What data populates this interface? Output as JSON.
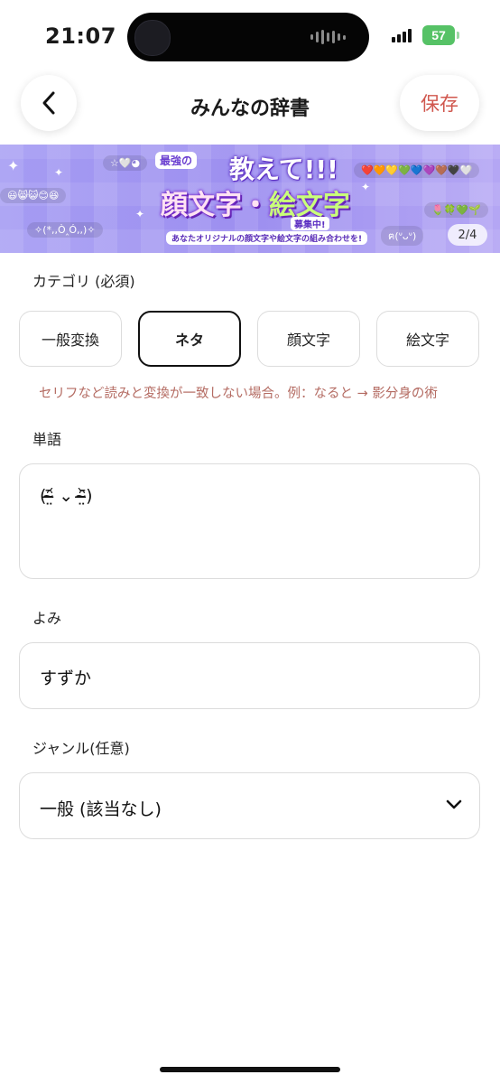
{
  "status_bar": {
    "time": "21:07",
    "battery": "57"
  },
  "header": {
    "title": "みんなの辞書",
    "save_label": "保存"
  },
  "banner": {
    "subtitle": "最強の",
    "title_line1": "教えて!!!",
    "title_kaomoji": "顔文字",
    "title_connector": "・",
    "title_emoji": "絵文字",
    "badge": "募集中!",
    "caption": "あなたオリジナルの顔文字や絵文字の組み合わせを!",
    "kaomoji_left_top": "☆🤍◕",
    "kaomoji_left_mid": "😃😸😺😊😆",
    "kaomoji_left_bottom": "✧(*,,Ò‸Ó,,)✧",
    "emoji_right_top": "❤️🧡💛💚💙💜🤎🖤🤍",
    "emoji_right_mid": "🌷🍀💚🌱",
    "kaomoji_right_bottom": "ฅ(ᐡᴗᐡ)",
    "pager": "2/4"
  },
  "category": {
    "label": "カテゴリ (必須)",
    "options": [
      "一般変換",
      "ネタ",
      "顔文字",
      "絵文字"
    ],
    "selected": "ネタ",
    "hint": "セリフなど読みと変換が一致しない場合。例：なると → 影分身の術"
  },
  "word": {
    "label": "単語",
    "value": "(ᵔ̴̶̤᷄ ⌄ ᵔ̴̶̤᷅)"
  },
  "reading": {
    "label": "よみ",
    "value": "すずか"
  },
  "genre": {
    "label": "ジャンル(任意)",
    "value": "一般 (該当なし)"
  },
  "icons": [
    "back-chevron-icon",
    "chevron-down-icon",
    "signal-icon",
    "battery-icon",
    "sparkle-icon"
  ],
  "colors": {
    "accent": "#d0574e",
    "hint": "#b46b62",
    "banner_bg": "#a59cf3",
    "selected_border": "#111111"
  }
}
